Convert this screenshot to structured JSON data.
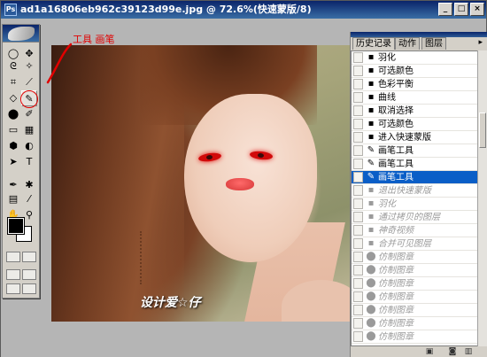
{
  "window": {
    "title": "ad1a16806eb962c39123d99e.jpg @ 72.6%(快速蒙版/8)",
    "app_icon": "photoshop-icon",
    "minimize_label": "_",
    "maximize_label": "□",
    "close_label": "×"
  },
  "annotation": {
    "text": "工具 画笔",
    "color": "#e10000"
  },
  "photo": {
    "watermark": "设计爱☆仔"
  },
  "toolbox": {
    "tools": [
      {
        "name": "marquee-icon",
        "glyph": "◯"
      },
      {
        "name": "move-icon",
        "glyph": "✥"
      },
      {
        "name": "lasso-icon",
        "glyph": "ᘓ"
      },
      {
        "name": "magic-wand-icon",
        "glyph": "✧"
      },
      {
        "name": "crop-icon",
        "glyph": "⌗"
      },
      {
        "name": "slice-icon",
        "glyph": "⟋"
      },
      {
        "name": "eraser-icon",
        "glyph": "◇"
      },
      {
        "name": "brush-icon",
        "glyph": "✎"
      },
      {
        "name": "stamp-icon",
        "glyph": "⬤"
      },
      {
        "name": "history-brush-icon",
        "glyph": "✐"
      },
      {
        "name": "eraser2-icon",
        "glyph": "▭"
      },
      {
        "name": "gradient-icon",
        "glyph": "▦"
      },
      {
        "name": "blur-icon",
        "glyph": "⬢"
      },
      {
        "name": "dodge-icon",
        "glyph": "◐"
      },
      {
        "name": "path-select-icon",
        "glyph": "➤"
      },
      {
        "name": "type-icon",
        "glyph": "T"
      },
      {
        "name": "pen-icon",
        "glyph": "✒"
      },
      {
        "name": "shape-icon",
        "glyph": "✱"
      },
      {
        "name": "notes-icon",
        "glyph": "▤"
      },
      {
        "name": "eyedropper-icon",
        "glyph": "⁄"
      },
      {
        "name": "hand-icon",
        "glyph": "✋"
      },
      {
        "name": "zoom-icon",
        "glyph": "⚲"
      }
    ],
    "foreground_color": "#000000",
    "background_color": "#ffffff"
  },
  "history_panel": {
    "tabs": [
      "历史记录",
      "动作",
      "图层"
    ],
    "active_tab": "历史记录",
    "menu_arrow": "▸",
    "items": [
      {
        "label": "羽化",
        "icon": "history-step-icon",
        "glyph": "▪",
        "state": "normal"
      },
      {
        "label": "可选颜色",
        "icon": "history-step-icon",
        "glyph": "▪",
        "state": "normal"
      },
      {
        "label": "色彩平衡",
        "icon": "history-step-icon",
        "glyph": "▪",
        "state": "normal"
      },
      {
        "label": "曲线",
        "icon": "history-step-icon",
        "glyph": "▪",
        "state": "normal"
      },
      {
        "label": "取消选择",
        "icon": "history-step-icon",
        "glyph": "▪",
        "state": "normal"
      },
      {
        "label": "可选颜色",
        "icon": "history-step-icon",
        "glyph": "▪",
        "state": "normal"
      },
      {
        "label": "进入快速蒙版",
        "icon": "history-step-icon",
        "glyph": "▪",
        "state": "normal"
      },
      {
        "label": "画笔工具",
        "icon": "brush-step-icon",
        "glyph": "✎",
        "state": "normal"
      },
      {
        "label": "画笔工具",
        "icon": "brush-step-icon",
        "glyph": "✎",
        "state": "normal"
      },
      {
        "label": "画笔工具",
        "icon": "brush-step-icon",
        "glyph": "✎",
        "state": "active"
      },
      {
        "label": "退出快速蒙版",
        "icon": "history-step-icon",
        "glyph": "▪",
        "state": "undone"
      },
      {
        "label": "羽化",
        "icon": "history-step-icon",
        "glyph": "▪",
        "state": "undone"
      },
      {
        "label": "通过拷贝的图层",
        "icon": "history-step-icon",
        "glyph": "▪",
        "state": "undone"
      },
      {
        "label": "神奇视频",
        "icon": "history-step-icon",
        "glyph": "▪",
        "state": "undone"
      },
      {
        "label": "合并可见图层",
        "icon": "history-step-icon",
        "glyph": "▪",
        "state": "undone"
      },
      {
        "label": "仿制图章",
        "icon": "stamp-step-icon",
        "glyph": "⬤",
        "state": "undone"
      },
      {
        "label": "仿制图章",
        "icon": "stamp-step-icon",
        "glyph": "⬤",
        "state": "undone"
      },
      {
        "label": "仿制图章",
        "icon": "stamp-step-icon",
        "glyph": "⬤",
        "state": "undone"
      },
      {
        "label": "仿制图章",
        "icon": "stamp-step-icon",
        "glyph": "⬤",
        "state": "undone"
      },
      {
        "label": "仿制图章",
        "icon": "stamp-step-icon",
        "glyph": "⬤",
        "state": "undone"
      },
      {
        "label": "仿制图章",
        "icon": "stamp-step-icon",
        "glyph": "⬤",
        "state": "undone"
      },
      {
        "label": "仿制图章",
        "icon": "stamp-step-icon",
        "glyph": "⬤",
        "state": "undone"
      }
    ]
  }
}
